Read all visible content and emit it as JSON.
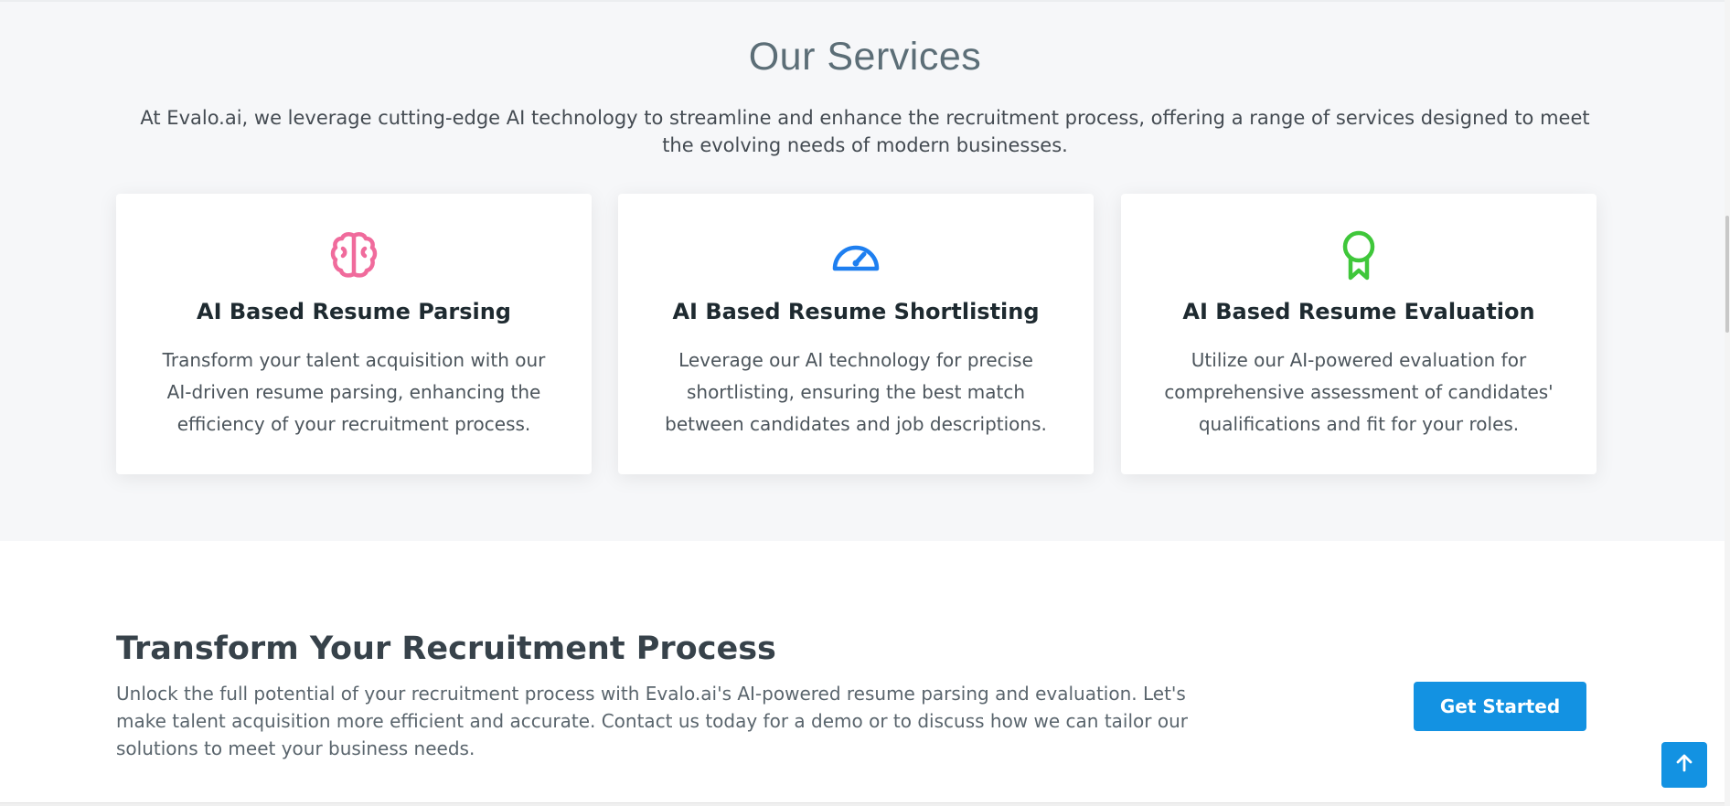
{
  "services": {
    "title": "Our Services",
    "intro": "At Evalo.ai, we leverage cutting-edge AI technology to streamline and enhance the recruitment process, offering a range of services designed to meet the evolving needs of modern businesses.",
    "cards": [
      {
        "icon": "brain-icon",
        "icon_color": "#f06b9c",
        "title": "AI Based Resume Parsing",
        "text": "Transform your talent acquisition with our AI-driven resume parsing, enhancing the efficiency of your recruitment process."
      },
      {
        "icon": "speedometer-icon",
        "icon_color": "#1e7ff0",
        "title": "AI Based Resume Shortlisting",
        "text": "Leverage our AI technology for precise shortlisting, ensuring the best match between candidates and job descriptions."
      },
      {
        "icon": "award-icon",
        "icon_color": "#3fc73a",
        "title": "AI Based Resume Evaluation",
        "text": "Utilize our AI-powered evaluation for comprehensive assessment of candidates' qualifications and fit for your roles."
      }
    ]
  },
  "cta": {
    "title": "Transform Your Recruitment Process",
    "text": "Unlock the full potential of your recruitment process with Evalo.ai's AI-powered resume parsing and evaluation. Let's make talent acquisition more efficient and accurate. Contact us today for a demo or to discuss how we can tailor our solutions to meet your business needs.",
    "button_label": "Get Started"
  },
  "back_to_top": {
    "icon": "arrow-up-icon"
  },
  "colors": {
    "accent": "#1392e2",
    "section_bg": "#f6f7f9"
  }
}
